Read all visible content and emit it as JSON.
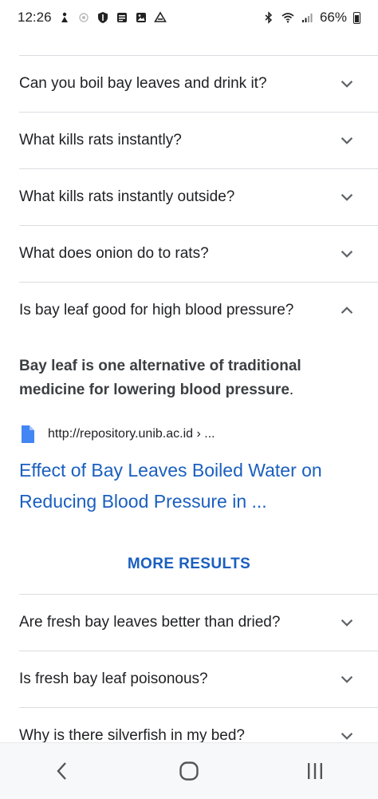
{
  "status_bar": {
    "time": "12:26",
    "battery": "66%",
    "left_icons": [
      "notification-icon",
      "circle-icon",
      "shield-icon",
      "news-icon",
      "gallery-icon",
      "drive-icon"
    ],
    "right_icons": [
      "bluetooth-icon",
      "wifi-icon",
      "signal-icon",
      "battery-icon"
    ]
  },
  "faq": {
    "questions_top": [
      "Can you boil bay leaves and drink it?",
      "What kills rats instantly?",
      "What kills rats instantly outside?",
      "What does onion do to rats?"
    ],
    "expanded": {
      "question": "Is bay leaf good for high blood pressure?",
      "answer_bold": "Bay leaf is one alternative of traditional medicine for lowering blood pressure",
      "answer_tail": ".",
      "source_url": "http://repository.unib.ac.id › ...",
      "source_title": "Effect of Bay Leaves Boiled Water on Reducing Blood Pressure in ..."
    },
    "more_results": "MORE RESULTS",
    "questions_bottom": [
      "Are fresh bay leaves better than dried?",
      "Is fresh bay leaf poisonous?",
      "Why is there silverfish in my bed?"
    ]
  },
  "colors": {
    "link": "#1a5fbf",
    "divider": "#dadce0",
    "text": "#202124"
  }
}
